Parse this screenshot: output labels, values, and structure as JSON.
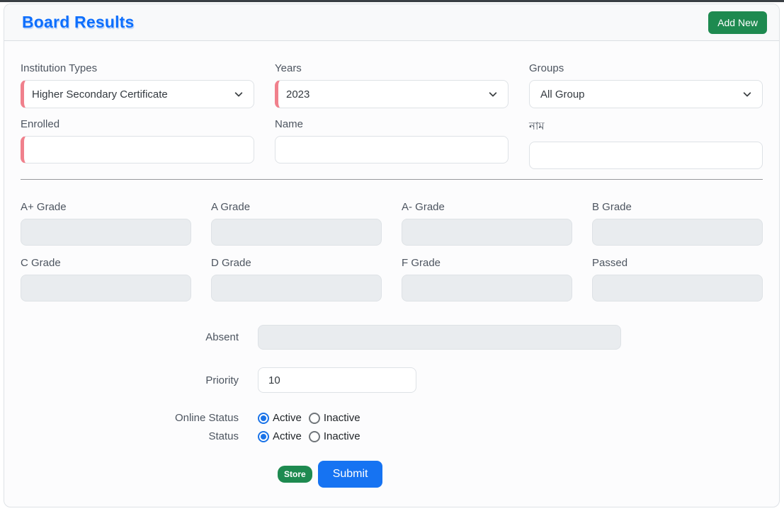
{
  "header": {
    "title": "Board Results",
    "add_new_label": "Add New"
  },
  "filters": [
    {
      "label": "Institution Types",
      "value": "Higher Secondary Certificate",
      "required": true
    },
    {
      "label": "Years",
      "value": "2023",
      "required": true
    },
    {
      "label": "Groups",
      "value": "All Group",
      "required": false
    }
  ],
  "text_fields": [
    {
      "label": "Enrolled",
      "value": "",
      "required": true
    },
    {
      "label": "Name",
      "value": "",
      "required": false
    },
    {
      "label": "নাম",
      "value": "",
      "required": false
    }
  ],
  "grades": [
    {
      "label": "A+ Grade",
      "value": ""
    },
    {
      "label": "A Grade",
      "value": ""
    },
    {
      "label": "A- Grade",
      "value": ""
    },
    {
      "label": "B Grade",
      "value": ""
    },
    {
      "label": "C Grade",
      "value": ""
    },
    {
      "label": "D Grade",
      "value": ""
    },
    {
      "label": "F Grade",
      "value": ""
    },
    {
      "label": "Passed",
      "value": ""
    }
  ],
  "absent": {
    "label": "Absent",
    "value": ""
  },
  "priority": {
    "label": "Priority",
    "value": "10",
    "required": true
  },
  "radio_rows": [
    {
      "label": "Online Status",
      "options": [
        {
          "label": "Active",
          "checked": true
        },
        {
          "label": "Inactive",
          "checked": false
        }
      ]
    },
    {
      "label": "Status",
      "options": [
        {
          "label": "Active",
          "checked": true
        },
        {
          "label": "Inactive",
          "checked": false
        }
      ]
    }
  ],
  "actions": {
    "store_badge": "Store",
    "submit_label": "Submit"
  },
  "colors": {
    "accent_blue": "#0d6efd",
    "submit_blue": "#1673f2",
    "success_green": "#1e8a50",
    "required_red": "#f0808c",
    "disabled_gray": "#e9ecef",
    "border_gray": "#dee2e6"
  }
}
